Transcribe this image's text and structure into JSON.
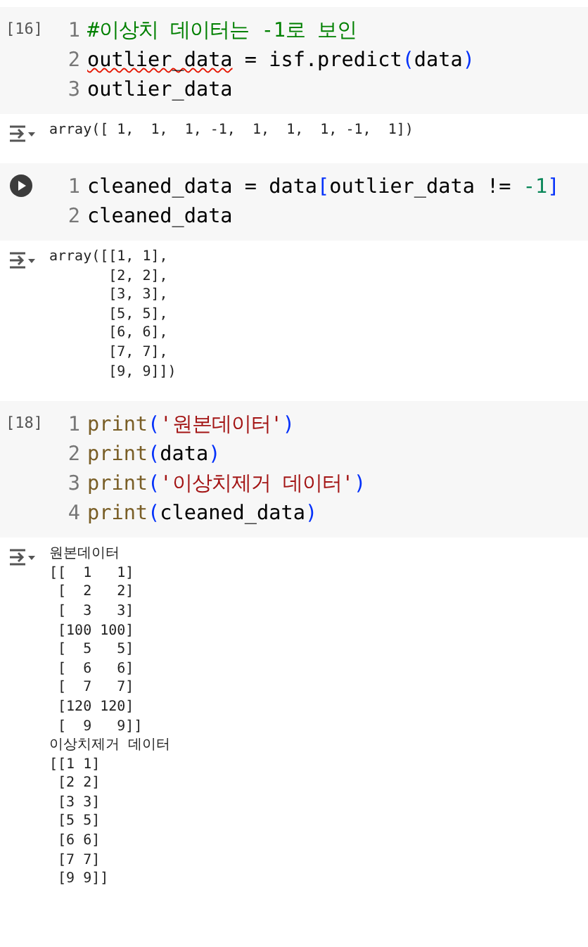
{
  "cells": [
    {
      "kind": "done",
      "execution_count": "[16]",
      "lines": [
        {
          "number": "1",
          "tokens": [
            {
              "kind": "comment",
              "text": "#이상치 데이터는 -1로 보인"
            }
          ]
        },
        {
          "number": "2",
          "tokens": [
            {
              "kind": "plain",
              "text": "outlier_data",
              "misspelled": true
            },
            {
              "kind": "plain",
              "text": " = isf.predict",
              "misspelled": false
            },
            {
              "kind": "bracket",
              "text": "("
            },
            {
              "kind": "plain",
              "text": "data",
              "misspelled": false
            },
            {
              "kind": "bracket",
              "text": ")"
            }
          ]
        },
        {
          "number": "3",
          "tokens": [
            {
              "kind": "plain",
              "text": "outlier_data",
              "misspelled": false
            }
          ]
        }
      ],
      "output": [
        "array([ 1,  1,  1, -1,  1,  1,  1, -1,  1])"
      ]
    },
    {
      "kind": "run",
      "lines": [
        {
          "number": "1",
          "tokens": [
            {
              "kind": "plain",
              "text": "cleaned_data = data",
              "misspelled": false
            },
            {
              "kind": "bracket",
              "text": "["
            },
            {
              "kind": "plain",
              "text": "outlier_data != ",
              "misspelled": false
            },
            {
              "kind": "number",
              "text": "-1"
            },
            {
              "kind": "bracket",
              "text": "]"
            }
          ]
        },
        {
          "number": "2",
          "tokens": [
            {
              "kind": "plain",
              "text": "cleaned_data",
              "misspelled": false
            }
          ]
        }
      ],
      "output": [
        "array([[1, 1],",
        "       [2, 2],",
        "       [3, 3],",
        "       [5, 5],",
        "       [6, 6],",
        "       [7, 7],",
        "       [9, 9]])"
      ]
    },
    {
      "kind": "done",
      "execution_count": "[18]",
      "lines": [
        {
          "number": "1",
          "tokens": [
            {
              "kind": "builtin",
              "text": "print"
            },
            {
              "kind": "bracket",
              "text": "("
            },
            {
              "kind": "string",
              "text": "'원본데이터'"
            },
            {
              "kind": "bracket",
              "text": ")"
            }
          ]
        },
        {
          "number": "2",
          "tokens": [
            {
              "kind": "builtin",
              "text": "print"
            },
            {
              "kind": "bracket",
              "text": "("
            },
            {
              "kind": "plain",
              "text": "data",
              "misspelled": false
            },
            {
              "kind": "bracket",
              "text": ")"
            }
          ]
        },
        {
          "number": "3",
          "tokens": [
            {
              "kind": "builtin",
              "text": "print"
            },
            {
              "kind": "bracket",
              "text": "("
            },
            {
              "kind": "string",
              "text": "'이상치제거 데이터'"
            },
            {
              "kind": "bracket",
              "text": ")"
            }
          ]
        },
        {
          "number": "4",
          "tokens": [
            {
              "kind": "builtin",
              "text": "print"
            },
            {
              "kind": "bracket",
              "text": "("
            },
            {
              "kind": "plain",
              "text": "cleaned_data",
              "misspelled": false
            },
            {
              "kind": "bracket",
              "text": ")"
            }
          ]
        }
      ],
      "output": [
        "원본데이터",
        "[[  1   1]",
        " [  2   2]",
        " [  3   3]",
        " [100 100]",
        " [  5   5]",
        " [  6   6]",
        " [  7   7]",
        " [120 120]",
        " [  9   9]]",
        "이상치제거 데이터",
        "[[1 1]",
        " [2 2]",
        " [3 3]",
        " [5 5]",
        " [6 6]",
        " [7 7]",
        " [9 9]]"
      ]
    }
  ]
}
